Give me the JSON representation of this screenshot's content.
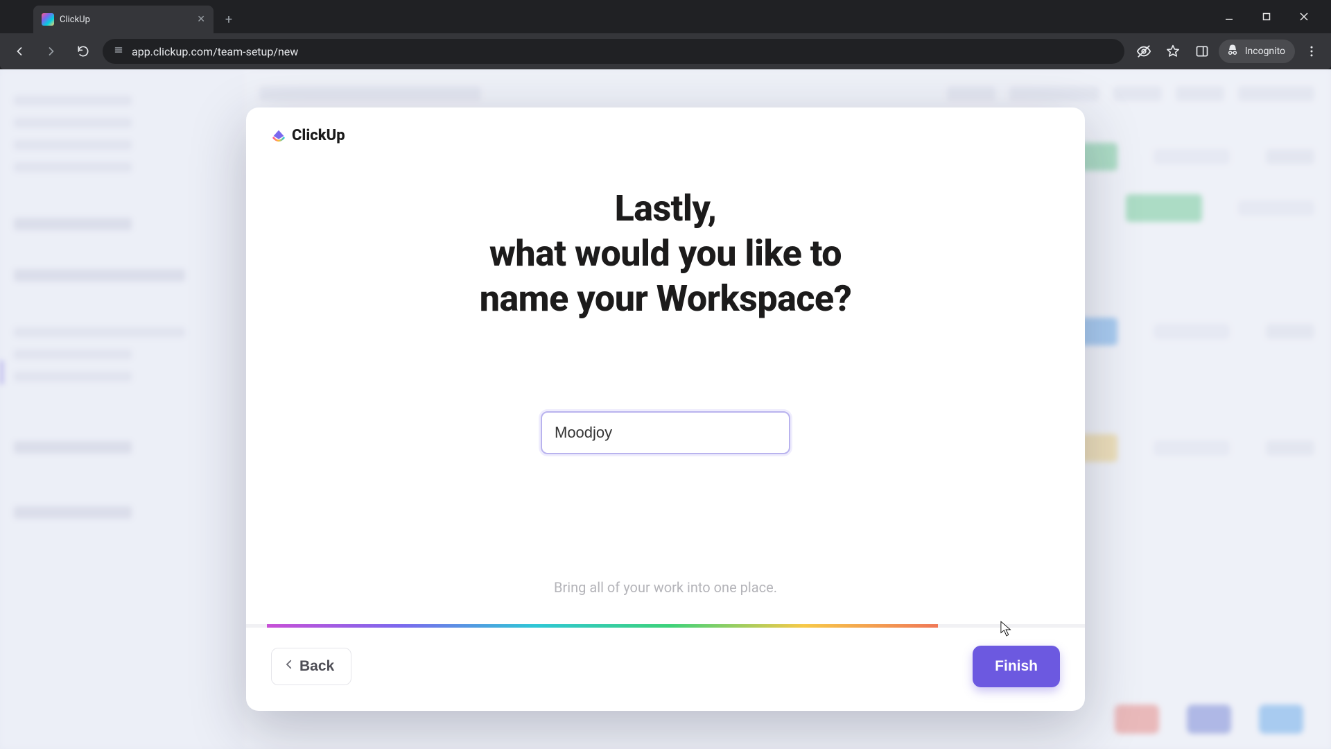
{
  "browser": {
    "tab_title": "ClickUp",
    "url": "app.clickup.com/team-setup/new",
    "incognito_label": "Incognito"
  },
  "modal": {
    "brand": "ClickUp",
    "heading_line1": "Lastly,",
    "heading_line2": "what would you like to",
    "heading_line3": "name your Workspace?",
    "input_value": "Moodjoy",
    "subtext": "Bring all of your work into one place.",
    "back_label": "Back",
    "finish_label": "Finish"
  },
  "colors": {
    "accent": "#6c59e0"
  }
}
